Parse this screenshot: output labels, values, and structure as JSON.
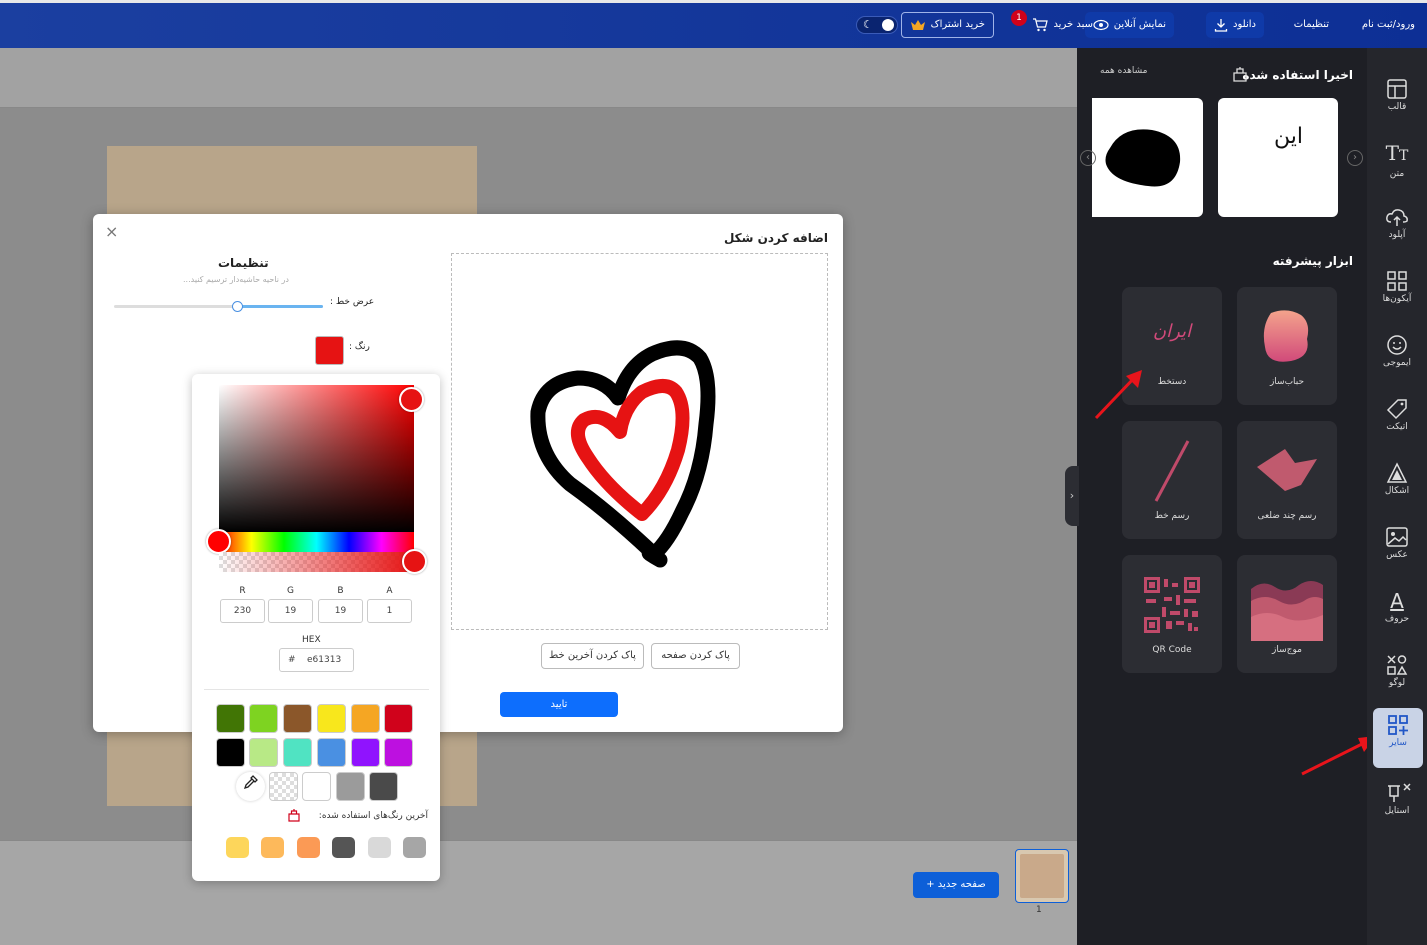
{
  "topbar": {
    "login": "ورود/ثبت نام",
    "settings": "تنظیمات",
    "download": "دانلود",
    "online_preview": "نمایش آنلاین",
    "cart": "سبد خرید",
    "cart_count": "1",
    "subscribe": "خرید اشتراک"
  },
  "side_panel": {
    "recent_title": "اخیرا استفاده شده",
    "see_all": "مشاهده همه",
    "recent_thumb_text": "این",
    "advanced_title": "ابزار پیشرفته",
    "tools": [
      {
        "label": "حباب‌ساز",
        "icon": "blob-icon"
      },
      {
        "label": "دستخط",
        "icon": "handwriting-icon",
        "art": "ایران"
      },
      {
        "label": "رسم چند ضلعی",
        "icon": "polygon-icon"
      },
      {
        "label": "رسم خط",
        "icon": "line-icon"
      },
      {
        "label": "موج‌ساز",
        "icon": "wave-icon"
      },
      {
        "label": "QR Code",
        "icon": "qr-code-icon"
      }
    ]
  },
  "rail": {
    "items": [
      {
        "label": "قالب",
        "icon": "template-icon"
      },
      {
        "label": "متن",
        "icon": "text-icon"
      },
      {
        "label": "آپلود",
        "icon": "upload-icon"
      },
      {
        "label": "آیکون‌ها",
        "icon": "icons-grid-icon"
      },
      {
        "label": "ایموجی",
        "icon": "emoji-icon"
      },
      {
        "label": "اتیکت",
        "icon": "tag-icon"
      },
      {
        "label": "اشکال",
        "icon": "shapes-icon"
      },
      {
        "label": "عکس",
        "icon": "image-icon"
      },
      {
        "label": "حروف",
        "icon": "letter-icon"
      },
      {
        "label": "لوگو",
        "icon": "logo-icon"
      },
      {
        "label": "سایر",
        "icon": "other-icon"
      },
      {
        "label": "استایل",
        "icon": "style-icon"
      }
    ],
    "active": "سایر"
  },
  "modal": {
    "title": "اضافه کردن شکل",
    "settings_title": "تنظیمات",
    "settings_hint": "در ناحیه حاشیه‌دار ترسیم کنید...",
    "stroke_width_label": "عرض خط :",
    "stroke_width_fraction": 0.41,
    "color_label": "رنگ :",
    "clear_page": "پاک کردن صفحه",
    "clear_last_line": "پاک کردن آخرین خط",
    "confirm": "تایید"
  },
  "color_picker": {
    "r_label": "R",
    "r": "230",
    "g_label": "G",
    "g": "19",
    "b_label": "B",
    "b": "19",
    "a_label": "A",
    "a": "1",
    "hex_label": "HEX",
    "hex_prefix": "#",
    "hex": "e61313",
    "swatches": [
      "#417505",
      "#7ed321",
      "#8b572a",
      "#f8e71c",
      "#f5a623",
      "#d0021b",
      "#000000",
      "#b8e986",
      "#50e3c2",
      "#4a90e2",
      "#9013fe",
      "#bd10e0"
    ],
    "gray_swatches": [
      "transparent",
      "#ffffff",
      "#9b9b9b",
      "#4a4a4a"
    ],
    "recent_label": "آخرین رنگ‌های استفاده شده:",
    "recent_colors": [
      "#fdd65b",
      "#fdb95b",
      "#fb9a55",
      "#555555",
      "#d9d9d9",
      "#a6a6a6"
    ]
  },
  "bottom": {
    "new_page": "صفحه جدید",
    "page_number": "1"
  },
  "colors": {
    "topbar": "#0d2f95",
    "accent": "#0d6efd",
    "selected": "#e61313"
  }
}
